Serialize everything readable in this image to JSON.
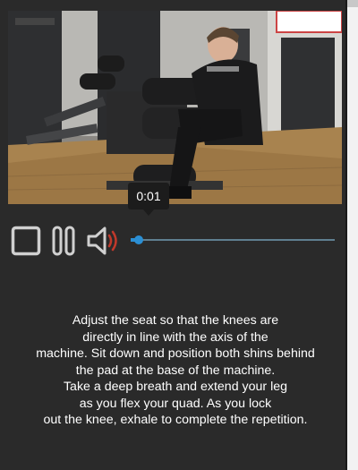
{
  "video": {
    "current_time": "0:01",
    "progress": 0.04
  },
  "controls": {
    "stop_icon": "stop-icon",
    "pause_icon": "pause-icon",
    "volume_icon": "volume-icon",
    "icon_color": "#d0d0d0",
    "volume_wave_color": "#c0392b",
    "accent_color": "#2b8fd4"
  },
  "description": {
    "lines": [
      "Adjust the seat so that the knees are",
      "directly in line with the axis of the",
      "machine. Sit down and position both shins behind",
      "the pad at the base of the machine.",
      "Take a deep breath and extend your leg",
      "as you flex your quad. As you lock",
      "out the knee, exhale to complete the repetition."
    ]
  }
}
